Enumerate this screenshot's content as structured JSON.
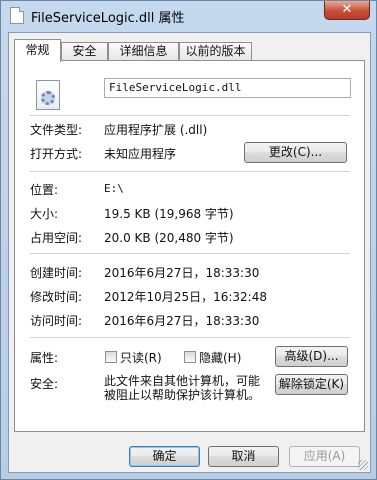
{
  "window": {
    "title": "FileServiceLogic.dll 属性",
    "close_glyph": "✕"
  },
  "tabs": [
    {
      "label": "常规",
      "active": true
    },
    {
      "label": "安全",
      "active": false
    },
    {
      "label": "详细信息",
      "active": false
    },
    {
      "label": "以前的版本",
      "active": false
    }
  ],
  "general": {
    "file_name": "FileServiceLogic.dll",
    "file_type_label": "文件类型:",
    "file_type_value": "应用程序扩展 (.dll)",
    "opens_with_label": "打开方式:",
    "opens_with_value": "未知应用程序",
    "change_button": "更改(C)...",
    "location_label": "位置:",
    "location_value": "E:\\",
    "size_label": "大小:",
    "size_value": "19.5 KB (19,968 字节)",
    "size_on_disk_label": "占用空间:",
    "size_on_disk_value": "20.0 KB (20,480 字节)",
    "created_label": "创建时间:",
    "created_value": "2016年6月27日，18:33:30",
    "modified_label": "修改时间:",
    "modified_value": "2012年10月25日，16:32:48",
    "accessed_label": "访问时间:",
    "accessed_value": "2016年6月27日，18:33:30",
    "attributes_label": "属性:",
    "readonly_label": "只读(R)",
    "hidden_label": "隐藏(H)",
    "advanced_button": "高级(D)...",
    "security_label": "安全:",
    "security_line1": "此文件来自其他计算机，可能",
    "security_line2": "被阻止以帮助保护该计算机。",
    "unblock_button": "解除锁定(K)"
  },
  "footer": {
    "ok": "确定",
    "cancel": "取消",
    "apply": "应用(A)"
  },
  "icons": {
    "title_icon": "dll-file-icon",
    "file_icon": "dll-gear-file-icon"
  }
}
